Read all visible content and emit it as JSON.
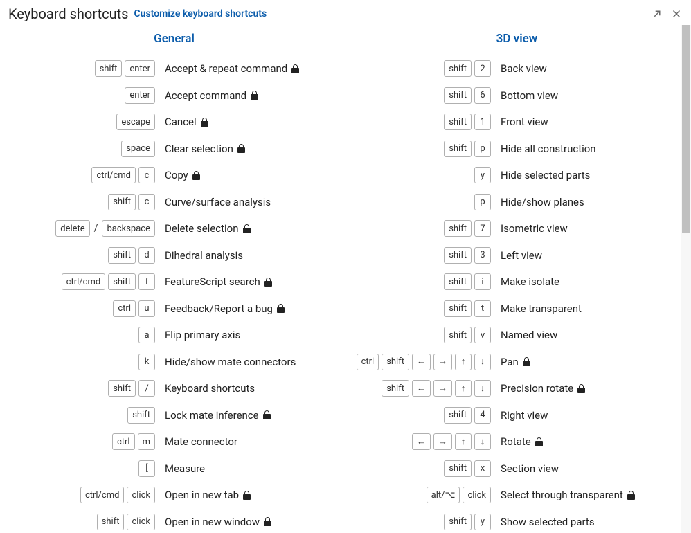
{
  "header": {
    "title": "Keyboard shortcuts",
    "customize": "Customize keyboard shortcuts"
  },
  "sections": {
    "general": {
      "title": "General",
      "rows": [
        {
          "keys": [
            [
              "shift"
            ],
            [
              "enter"
            ]
          ],
          "action": "Accept & repeat command",
          "locked": true
        },
        {
          "keys": [
            [
              "enter"
            ]
          ],
          "action": "Accept command",
          "locked": true
        },
        {
          "keys": [
            [
              "escape"
            ]
          ],
          "action": "Cancel",
          "locked": true
        },
        {
          "keys": [
            [
              "space"
            ]
          ],
          "action": "Clear selection",
          "locked": true
        },
        {
          "keys": [
            [
              "ctrl/cmd"
            ],
            [
              "c"
            ]
          ],
          "action": "Copy",
          "locked": true
        },
        {
          "keys": [
            [
              "shift"
            ],
            [
              "c"
            ]
          ],
          "action": "Curve/surface analysis",
          "locked": false
        },
        {
          "keys": [
            [
              "delete"
            ],
            "/",
            [
              "backspace"
            ]
          ],
          "action": "Delete selection",
          "locked": true
        },
        {
          "keys": [
            [
              "shift"
            ],
            [
              "d"
            ]
          ],
          "action": "Dihedral analysis",
          "locked": false
        },
        {
          "keys": [
            [
              "ctrl/cmd"
            ],
            [
              "shift"
            ],
            [
              "f"
            ]
          ],
          "action": "FeatureScript search",
          "locked": true
        },
        {
          "keys": [
            [
              "ctrl"
            ],
            [
              "u"
            ]
          ],
          "action": "Feedback/Report a bug",
          "locked": true
        },
        {
          "keys": [
            [
              "a"
            ]
          ],
          "action": "Flip primary axis",
          "locked": false
        },
        {
          "keys": [
            [
              "k"
            ]
          ],
          "action": "Hide/show mate connectors",
          "locked": false
        },
        {
          "keys": [
            [
              "shift"
            ],
            [
              "/"
            ]
          ],
          "action": "Keyboard shortcuts",
          "locked": false
        },
        {
          "keys": [
            [
              "shift"
            ]
          ],
          "action": "Lock mate inference",
          "locked": true
        },
        {
          "keys": [
            [
              "ctrl"
            ],
            [
              "m"
            ]
          ],
          "action": "Mate connector",
          "locked": false
        },
        {
          "keys": [
            [
              "["
            ]
          ],
          "action": "Measure",
          "locked": false
        },
        {
          "keys": [
            [
              "ctrl/cmd"
            ],
            [
              "click"
            ]
          ],
          "action": "Open in new tab",
          "locked": true
        },
        {
          "keys": [
            [
              "shift"
            ],
            [
              "click"
            ]
          ],
          "action": "Open in new window",
          "locked": true
        }
      ]
    },
    "view3d": {
      "title": "3D view",
      "rows": [
        {
          "keys": [
            [
              "shift"
            ],
            [
              "2"
            ]
          ],
          "action": "Back view",
          "locked": false
        },
        {
          "keys": [
            [
              "shift"
            ],
            [
              "6"
            ]
          ],
          "action": "Bottom view",
          "locked": false
        },
        {
          "keys": [
            [
              "shift"
            ],
            [
              "1"
            ]
          ],
          "action": "Front view",
          "locked": false
        },
        {
          "keys": [
            [
              "shift"
            ],
            [
              "p"
            ]
          ],
          "action": "Hide all construction",
          "locked": false
        },
        {
          "keys": [
            [
              "y"
            ]
          ],
          "action": "Hide selected parts",
          "locked": false
        },
        {
          "keys": [
            [
              "p"
            ]
          ],
          "action": "Hide/show planes",
          "locked": false
        },
        {
          "keys": [
            [
              "shift"
            ],
            [
              "7"
            ]
          ],
          "action": "Isometric view",
          "locked": false
        },
        {
          "keys": [
            [
              "shift"
            ],
            [
              "3"
            ]
          ],
          "action": "Left view",
          "locked": false
        },
        {
          "keys": [
            [
              "shift"
            ],
            [
              "i"
            ]
          ],
          "action": "Make isolate",
          "locked": false
        },
        {
          "keys": [
            [
              "shift"
            ],
            [
              "t"
            ]
          ],
          "action": "Make transparent",
          "locked": false
        },
        {
          "keys": [
            [
              "shift"
            ],
            [
              "v"
            ]
          ],
          "action": "Named view",
          "locked": false
        },
        {
          "keys": [
            [
              "ctrl"
            ],
            [
              "shift"
            ],
            [
              "←"
            ],
            [
              "→"
            ],
            [
              "↑"
            ],
            [
              "↓"
            ]
          ],
          "action": "Pan",
          "locked": true
        },
        {
          "keys": [
            [
              "shift"
            ],
            [
              "←"
            ],
            [
              "→"
            ],
            [
              "↑"
            ],
            [
              "↓"
            ]
          ],
          "action": "Precision rotate",
          "locked": true
        },
        {
          "keys": [
            [
              "shift"
            ],
            [
              "4"
            ]
          ],
          "action": "Right view",
          "locked": false
        },
        {
          "keys": [
            [
              "←"
            ],
            [
              "→"
            ],
            [
              "↑"
            ],
            [
              "↓"
            ]
          ],
          "action": "Rotate",
          "locked": true
        },
        {
          "keys": [
            [
              "shift"
            ],
            [
              "x"
            ]
          ],
          "action": "Section view",
          "locked": false
        },
        {
          "keys": [
            [
              "alt/⌥"
            ],
            [
              "click"
            ]
          ],
          "action": "Select through transparent",
          "locked": true
        },
        {
          "keys": [
            [
              "shift"
            ],
            [
              "y"
            ]
          ],
          "action": "Show selected parts",
          "locked": false
        }
      ]
    }
  }
}
